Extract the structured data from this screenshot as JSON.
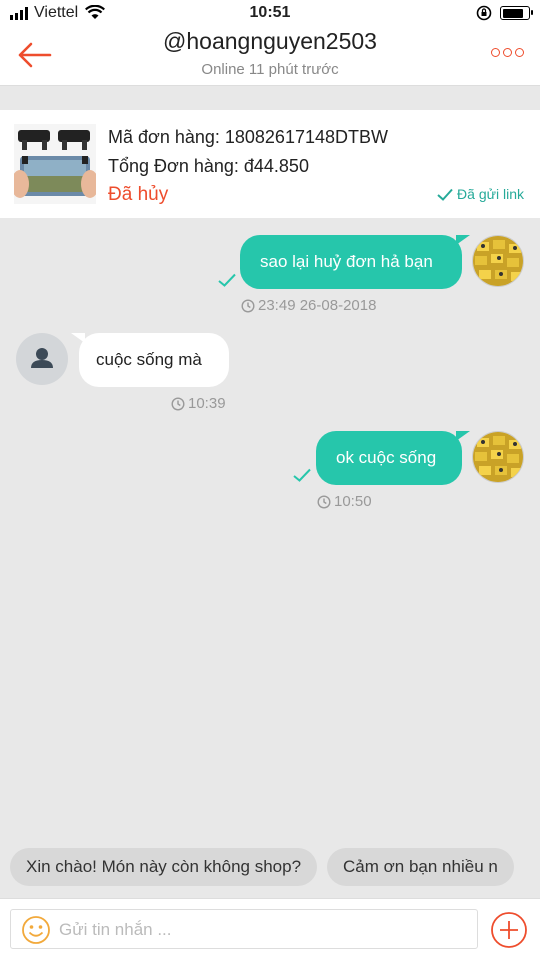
{
  "status_bar": {
    "carrier": "Viettel",
    "time": "10:51"
  },
  "header": {
    "title": "@hoangnguyen2503",
    "subtitle": "Online 11 phút trước"
  },
  "order": {
    "code": "Mã đơn hàng: 18082617148DTBW",
    "total": "Tổng Đơn hàng: đ44.850",
    "status": "Đã hủy",
    "link_status": "Đã gửi link"
  },
  "messages": [
    {
      "direction": "out",
      "text": "sao lại huỷ đơn hả bạn",
      "time": "23:49 26-08-2018"
    },
    {
      "direction": "in",
      "text": "cuộc sống mà",
      "time": "10:39"
    },
    {
      "direction": "out",
      "text": "ok cuộc sống",
      "time": "10:50"
    }
  ],
  "quick_replies": [
    "Xin chào! Món này còn không shop?",
    "Cảm ơn bạn nhiều n"
  ],
  "input": {
    "placeholder": "Gửi tin nhắn ..."
  },
  "colors": {
    "accent": "#ee4d2d",
    "bubble_out": "#26c6ab",
    "link_green": "#26aa99"
  }
}
